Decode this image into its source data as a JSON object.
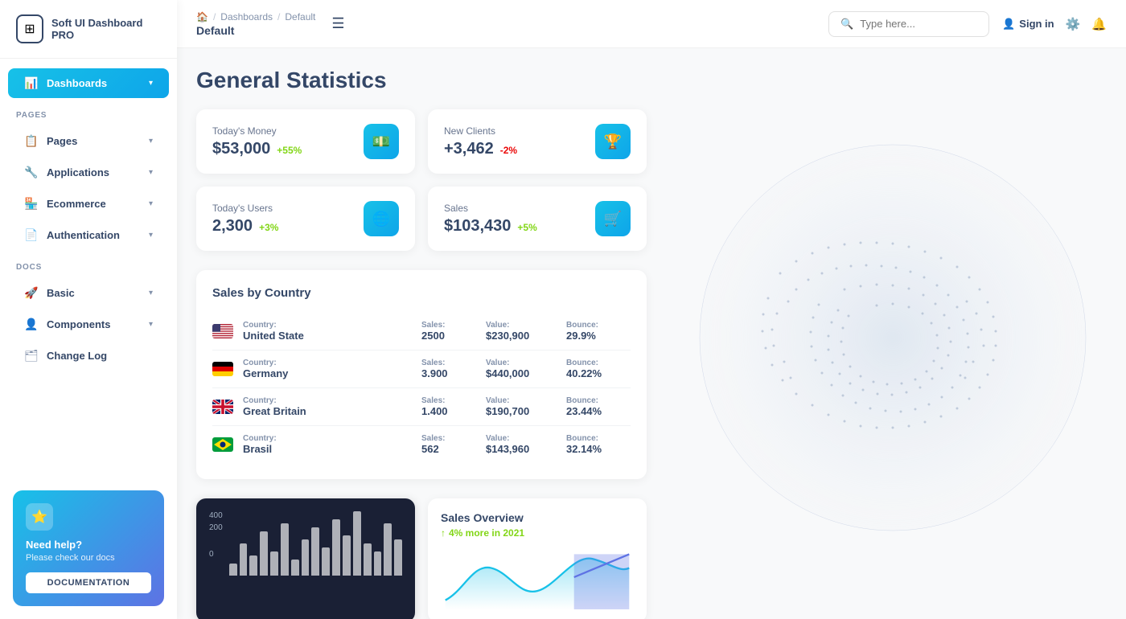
{
  "app": {
    "name": "Soft UI Dashboard PRO"
  },
  "breadcrumb": {
    "home_icon": "🏠",
    "path1": "Dashboards",
    "path2": "Default",
    "current": "Default"
  },
  "header": {
    "search_placeholder": "Type here...",
    "sign_in": "Sign in",
    "hamburger": "☰"
  },
  "sidebar": {
    "section_pages": "PAGES",
    "section_docs": "DOCS",
    "nav_items": [
      {
        "id": "dashboards",
        "label": "Dashboards",
        "icon": "📊",
        "active": true,
        "has_chevron": true
      },
      {
        "id": "pages",
        "label": "Pages",
        "icon": "📋",
        "active": false,
        "has_chevron": true
      },
      {
        "id": "applications",
        "label": "Applications",
        "icon": "🔧",
        "active": false,
        "has_chevron": true
      },
      {
        "id": "ecommerce",
        "label": "Ecommerce",
        "icon": "🏪",
        "active": false,
        "has_chevron": true
      },
      {
        "id": "authentication",
        "label": "Authentication",
        "icon": "📄",
        "active": false,
        "has_chevron": true
      },
      {
        "id": "basic",
        "label": "Basic",
        "icon": "🚀",
        "active": false,
        "has_chevron": true
      },
      {
        "id": "components",
        "label": "Components",
        "icon": "👤",
        "active": false,
        "has_chevron": true
      },
      {
        "id": "changelog",
        "label": "Change Log",
        "icon": "🗂",
        "active": false,
        "has_chevron": false
      }
    ],
    "help": {
      "title": "Need help?",
      "subtitle": "Please check our docs",
      "button_label": "DOCUMENTATION"
    }
  },
  "page": {
    "title": "General Statistics"
  },
  "stats": [
    {
      "id": "money",
      "label": "Today's Money",
      "value": "$53,000",
      "change": "+55%",
      "change_type": "positive",
      "icon": "💵"
    },
    {
      "id": "clients",
      "label": "New Clients",
      "value": "+3,462",
      "change": "-2%",
      "change_type": "negative",
      "icon": "🏆"
    },
    {
      "id": "users",
      "label": "Today's Users",
      "value": "2,300",
      "change": "+3%",
      "change_type": "positive",
      "icon": "🌐"
    },
    {
      "id": "sales",
      "label": "Sales",
      "value": "$103,430",
      "change": "+5%",
      "change_type": "positive",
      "icon": "🛒"
    }
  ],
  "sales_by_country": {
    "title": "Sales by Country",
    "columns": [
      "Country:",
      "Sales:",
      "Value:",
      "Bounce:"
    ],
    "rows": [
      {
        "country": "United State",
        "flag": "us",
        "sales": "2500",
        "value": "$230,900",
        "bounce": "29.9%"
      },
      {
        "country": "Germany",
        "flag": "de",
        "sales": "3.900",
        "value": "$440,000",
        "bounce": "40.22%"
      },
      {
        "country": "Great Britain",
        "flag": "gb",
        "sales": "1.400",
        "value": "$190,700",
        "bounce": "23.44%"
      },
      {
        "country": "Brasil",
        "flag": "br",
        "sales": "562",
        "value": "$143,960",
        "bounce": "32.14%"
      }
    ]
  },
  "bar_chart": {
    "y_labels": [
      "400",
      "200",
      "0"
    ],
    "bars": [
      15,
      40,
      25,
      55,
      30,
      65,
      20,
      45,
      60,
      35,
      70,
      50,
      80,
      40,
      30,
      65,
      45
    ]
  },
  "sales_overview": {
    "title": "Sales Overview",
    "subtitle": "4% more in 2021"
  }
}
